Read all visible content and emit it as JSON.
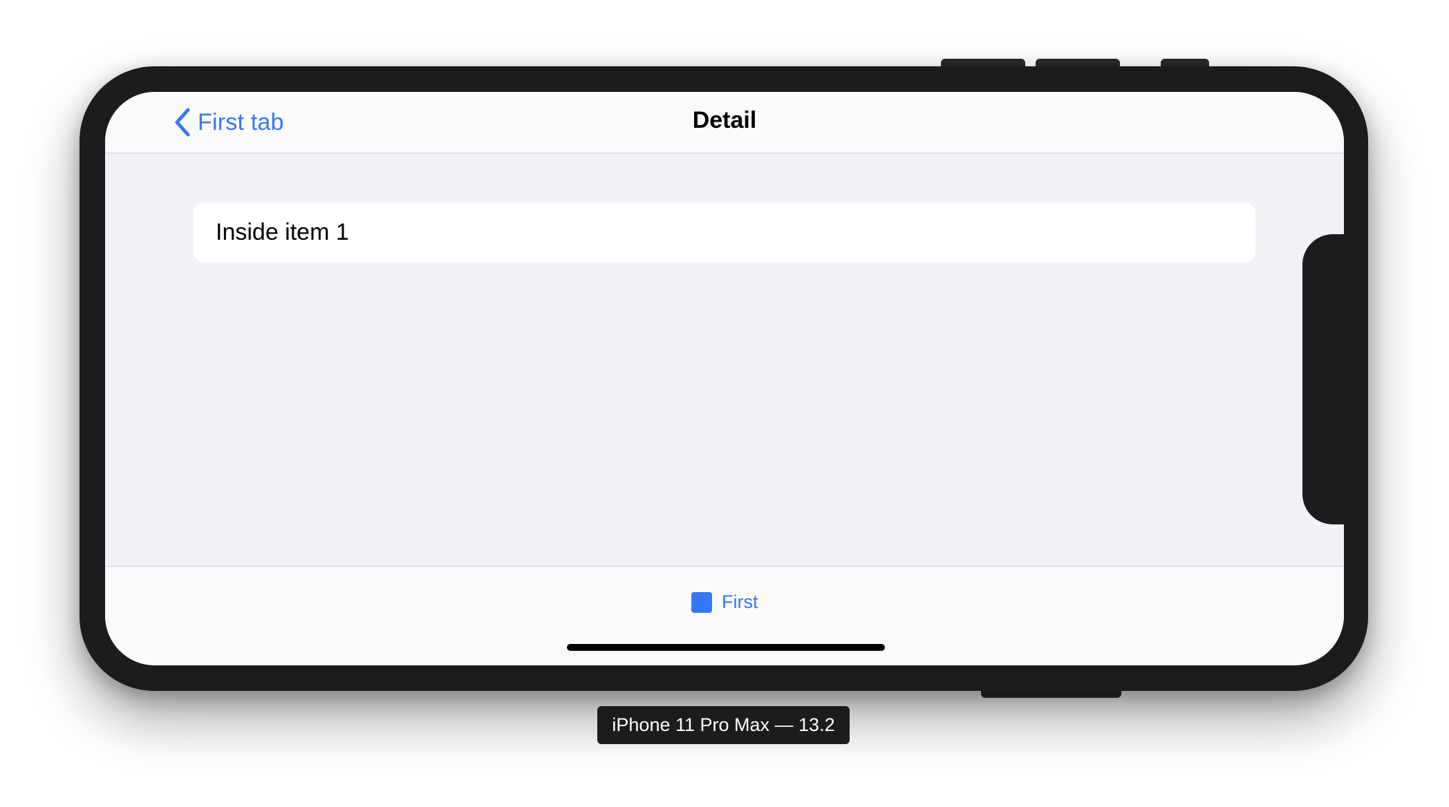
{
  "nav": {
    "back_label": "First tab",
    "title": "Detail"
  },
  "list": {
    "items": [
      {
        "label": "Inside item 1"
      }
    ]
  },
  "tabbar": {
    "items": [
      {
        "label": "First",
        "icon": "square-icon",
        "selected": true
      }
    ]
  },
  "device": {
    "caption": "iPhone 11 Pro Max — 13.2"
  },
  "colors": {
    "accent": "#3478f6",
    "background": "#f2f2f7",
    "frame": "#1c1c1e"
  }
}
